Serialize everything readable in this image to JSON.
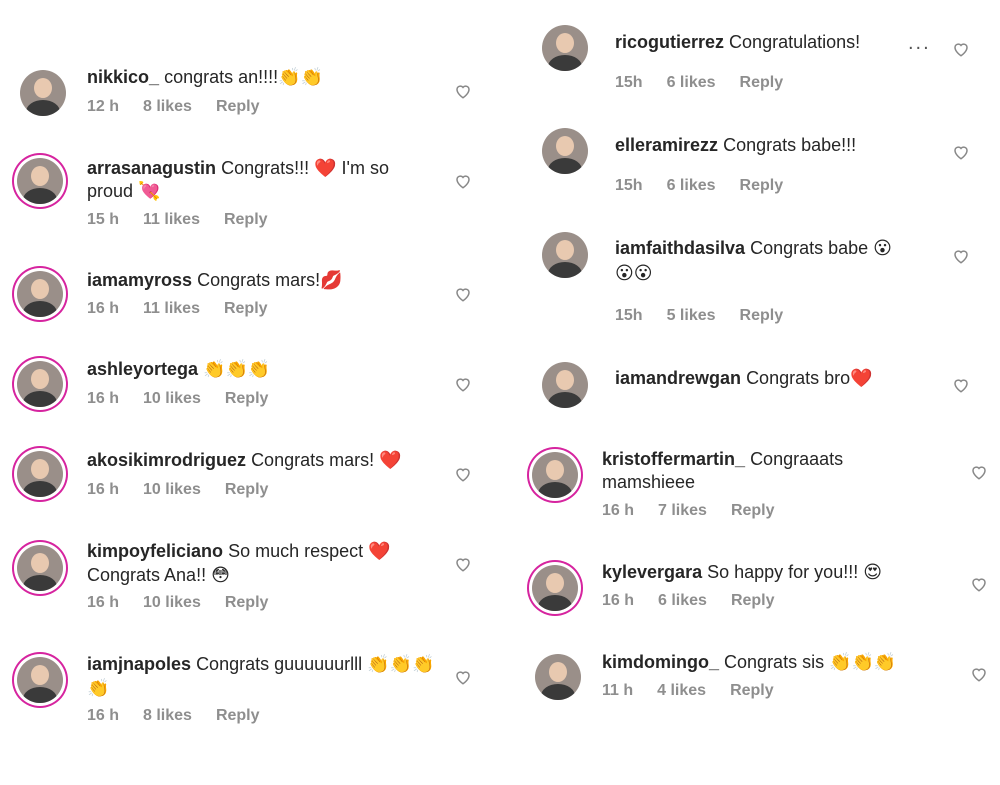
{
  "left_comments": [
    {
      "user": "nikkico_",
      "text": "congrats an!!!!👏👏",
      "time": "12 h",
      "likes": "8 likes",
      "reply": "Reply"
    },
    {
      "user": "arrasanagustin",
      "text": "Congrats!!! ❤️ I'm so",
      "text2": "proud 💘",
      "time": "15 h",
      "likes": "11 likes",
      "reply": "Reply"
    },
    {
      "user": "iamamyross",
      "text": "Congrats mars!💋",
      "time": "16 h",
      "likes": "11 likes",
      "reply": "Reply"
    },
    {
      "user": "ashleyortega",
      "text": "👏👏👏",
      "time": "16 h",
      "likes": "10 likes",
      "reply": "Reply"
    },
    {
      "user": "akosikimrodriguez",
      "text": "Congrats mars! ❤️",
      "time": "16 h",
      "likes": "10 likes",
      "reply": "Reply"
    },
    {
      "user": "kimpoyfeliciano",
      "text": "So much respect ❤️",
      "text2": "Congrats Ana!! 😳",
      "time": "16 h",
      "likes": "10 likes",
      "reply": "Reply"
    },
    {
      "user": "iamjnapoles",
      "text": "Congrats guuuuuurlll 👏👏👏",
      "text2": "👏",
      "time": "16 h",
      "likes": "8 likes",
      "reply": "Reply"
    }
  ],
  "right_comments": [
    {
      "user": "ricogutierrez",
      "text": "Congratulations!",
      "time": "15h",
      "likes": "6 likes",
      "reply": "Reply"
    },
    {
      "user": "elleramirezz",
      "text": "Congrats babe!!!",
      "time": "15h",
      "likes": "6 likes",
      "reply": "Reply"
    },
    {
      "user": "iamfaithdasilva",
      "text": "Congrats babe 😮",
      "text2": "😮😮",
      "time": "15h",
      "likes": "5 likes",
      "reply": "Reply"
    },
    {
      "user": "iamandrewgan",
      "text": "Congrats bro❤️",
      "time": "",
      "likes": "",
      "reply": ""
    },
    {
      "user": "kristoffermartin_",
      "text": "Congraaats",
      "text2": "mamshieee",
      "time": "16 h",
      "likes": "7 likes",
      "reply": "Reply"
    },
    {
      "user": "kylevergara",
      "text": "So happy for you!!! 😍",
      "time": "16 h",
      "likes": "6 likes",
      "reply": "Reply"
    },
    {
      "user": "kimdomingo_",
      "text": "Congrats sis 👏👏👏",
      "time": "11 h",
      "likes": "4 likes",
      "reply": "Reply"
    }
  ],
  "more_label": "...",
  "icons": {
    "like": "heart-icon",
    "more": "more-options-icon"
  }
}
